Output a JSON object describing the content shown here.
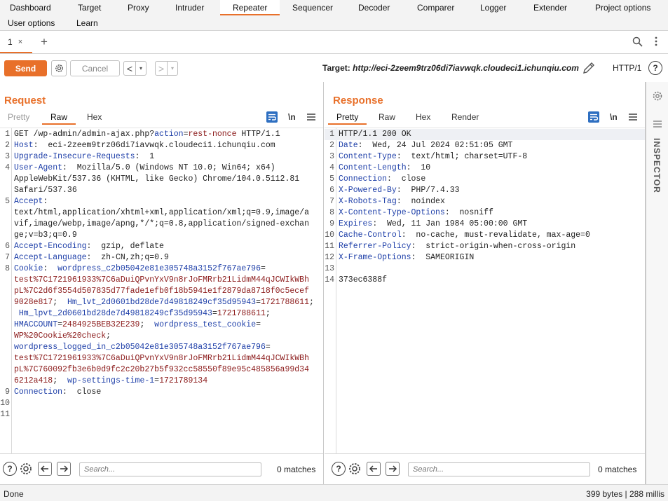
{
  "menu": {
    "row1": [
      "Dashboard",
      "Target",
      "Proxy",
      "Intruder",
      "Repeater",
      "Sequencer",
      "Decoder",
      "Comparer",
      "Logger",
      "Extender",
      "Project options"
    ],
    "row2": [
      "User options",
      "Learn"
    ],
    "active": "Repeater"
  },
  "subtab": {
    "label": "1",
    "close": "×",
    "add": "+"
  },
  "toolbar": {
    "send_label": "Send",
    "cancel_label": "Cancel",
    "prev_label": "<",
    "next_label": ">",
    "dropdown_glyph": "▾",
    "target_label": "Target:",
    "target_url": "http://eci-2zeem9trz06di7iavwqk.cloudeci1.ichunqiu.com",
    "protocol": "HTTP/1",
    "help_label": "?"
  },
  "request": {
    "title": "Request",
    "tabs": [
      "Pretty",
      "Raw",
      "Hex"
    ],
    "active_tab": "Raw",
    "newline_label": "\\n",
    "lines": [
      {
        "n": "1",
        "parts": [
          [
            "v",
            "GET /wp-admin/admin-ajax.php?"
          ],
          [
            "k",
            "action"
          ],
          [
            "v",
            "="
          ],
          [
            "p",
            "rest-nonce"
          ],
          [
            "v",
            " HTTP/1.1"
          ]
        ]
      },
      {
        "n": "2",
        "parts": [
          [
            "k",
            "Host"
          ],
          [
            "v",
            ":  eci-2zeem9trz06di7iavwqk.cloudeci1.ichunqiu.com"
          ]
        ]
      },
      {
        "n": "3",
        "parts": [
          [
            "k",
            "Upgrade-Insecure-Requests"
          ],
          [
            "v",
            ":  1"
          ]
        ]
      },
      {
        "n": "4",
        "parts": [
          [
            "k",
            "User-Agent"
          ],
          [
            "v",
            ":  Mozilla/5.0 (Windows NT 10.0; Win64; x64)"
          ]
        ]
      },
      {
        "n": "",
        "parts": [
          [
            "v",
            "AppleWebKit/537.36 (KHTML, like Gecko) Chrome/104.0.5112.81"
          ]
        ]
      },
      {
        "n": "",
        "parts": [
          [
            "v",
            "Safari/537.36"
          ]
        ]
      },
      {
        "n": "5",
        "parts": [
          [
            "k",
            "Accept"
          ],
          [
            "v",
            ":"
          ]
        ]
      },
      {
        "n": "",
        "parts": [
          [
            "v",
            "text/html,application/xhtml+xml,application/xml;q=0.9,image/a"
          ]
        ]
      },
      {
        "n": "",
        "parts": [
          [
            "v",
            "vif,image/webp,image/apng,*/*;q=0.8,application/signed-exchan"
          ]
        ]
      },
      {
        "n": "",
        "parts": [
          [
            "v",
            "ge;v=b3;q=0.9"
          ]
        ]
      },
      {
        "n": "6",
        "parts": [
          [
            "k",
            "Accept-Encoding"
          ],
          [
            "v",
            ":  gzip, deflate"
          ]
        ]
      },
      {
        "n": "7",
        "parts": [
          [
            "k",
            "Accept-Language"
          ],
          [
            "v",
            ":  zh-CN,zh;q=0.9"
          ]
        ]
      },
      {
        "n": "8",
        "parts": [
          [
            "k",
            "Cookie"
          ],
          [
            "v",
            ":  "
          ],
          [
            "k",
            "wordpress_c2b05042e81e305748a3152f767ae796"
          ],
          [
            "v",
            "="
          ]
        ]
      },
      {
        "n": "",
        "parts": [
          [
            "p",
            "test%7C1721961933%7C6aDuiQPvnYxV9n8rJoFMRrb21LidmM44qJCWIkWBh"
          ]
        ]
      },
      {
        "n": "",
        "parts": [
          [
            "p",
            "pL%7C2d6f3554d507835d77fade1efb0f18b5941e1f2879da8718f0c5ecef"
          ]
        ]
      },
      {
        "n": "",
        "parts": [
          [
            "p",
            "9028e817"
          ],
          [
            "v",
            ";  "
          ],
          [
            "k",
            "Hm_lvt_2d0601bd28de7d49818249cf35d95943"
          ],
          [
            "v",
            "="
          ],
          [
            "p",
            "1721788611"
          ],
          [
            "v",
            ";"
          ]
        ]
      },
      {
        "n": "",
        "parts": [
          [
            "v",
            " "
          ],
          [
            "k",
            "Hm_lpvt_2d0601bd28de7d49818249cf35d95943"
          ],
          [
            "v",
            "="
          ],
          [
            "p",
            "1721788611"
          ],
          [
            "v",
            ";"
          ]
        ]
      },
      {
        "n": "",
        "parts": [
          [
            "k",
            "HMACCOUNT"
          ],
          [
            "v",
            "="
          ],
          [
            "p",
            "2484925BEB32E239"
          ],
          [
            "v",
            ";  "
          ],
          [
            "k",
            "wordpress_test_cookie"
          ],
          [
            "v",
            "="
          ]
        ]
      },
      {
        "n": "",
        "parts": [
          [
            "p",
            "WP%20Cookie%20check"
          ],
          [
            "v",
            ";"
          ]
        ]
      },
      {
        "n": "",
        "parts": [
          [
            "k",
            "wordpress_logged_in_c2b05042e81e305748a3152f767ae796"
          ],
          [
            "v",
            "="
          ]
        ]
      },
      {
        "n": "",
        "parts": [
          [
            "p",
            "test%7C1721961933%7C6aDuiQPvnYxV9n8rJoFMRrb21LidmM44qJCWIkWBh"
          ]
        ]
      },
      {
        "n": "",
        "parts": [
          [
            "p",
            "pL%7C760092fb3e6b0d9fc2c20b27b5f932cc58550f89e95c485856a99d34"
          ]
        ]
      },
      {
        "n": "",
        "parts": [
          [
            "p",
            "6212a418"
          ],
          [
            "v",
            ";  "
          ],
          [
            "k",
            "wp-settings-time-1"
          ],
          [
            "v",
            "="
          ],
          [
            "p",
            "1721789134"
          ]
        ]
      },
      {
        "n": "9",
        "parts": [
          [
            "k",
            "Connection"
          ],
          [
            "v",
            ":  close"
          ]
        ]
      },
      {
        "n": "10",
        "parts": []
      },
      {
        "n": "11",
        "parts": []
      }
    ],
    "search_placeholder": "Search...",
    "matches": "0 matches"
  },
  "response": {
    "title": "Response",
    "tabs": [
      "Pretty",
      "Raw",
      "Hex",
      "Render"
    ],
    "active_tab": "Pretty",
    "newline_label": "\\n",
    "lines": [
      {
        "n": "1",
        "parts": [
          [
            "v",
            "HTTP/1.1 200 OK"
          ]
        ]
      },
      {
        "n": "2",
        "parts": [
          [
            "k",
            "Date"
          ],
          [
            "v",
            ":  Wed, 24 Jul 2024 02:51:05 GMT"
          ]
        ]
      },
      {
        "n": "3",
        "parts": [
          [
            "k",
            "Content-Type"
          ],
          [
            "v",
            ":  text/html; charset=UTF-8"
          ]
        ]
      },
      {
        "n": "4",
        "parts": [
          [
            "k",
            "Content-Length"
          ],
          [
            "v",
            ":  10"
          ]
        ]
      },
      {
        "n": "5",
        "parts": [
          [
            "k",
            "Connection"
          ],
          [
            "v",
            ":  close"
          ]
        ]
      },
      {
        "n": "6",
        "parts": [
          [
            "k",
            "X-Powered-By"
          ],
          [
            "v",
            ":  PHP/7.4.33"
          ]
        ]
      },
      {
        "n": "7",
        "parts": [
          [
            "k",
            "X-Robots-Tag"
          ],
          [
            "v",
            ":  noindex"
          ]
        ]
      },
      {
        "n": "8",
        "parts": [
          [
            "k",
            "X-Content-Type-Options"
          ],
          [
            "v",
            ":  nosniff"
          ]
        ]
      },
      {
        "n": "9",
        "parts": [
          [
            "k",
            "Expires"
          ],
          [
            "v",
            ":  Wed, 11 Jan 1984 05:00:00 GMT"
          ]
        ]
      },
      {
        "n": "10",
        "parts": [
          [
            "k",
            "Cache-Control"
          ],
          [
            "v",
            ":  no-cache, must-revalidate, max-age=0"
          ]
        ]
      },
      {
        "n": "11",
        "parts": [
          [
            "k",
            "Referrer-Policy"
          ],
          [
            "v",
            ":  strict-origin-when-cross-origin"
          ]
        ]
      },
      {
        "n": "12",
        "parts": [
          [
            "k",
            "X-Frame-Options"
          ],
          [
            "v",
            ":  SAMEORIGIN"
          ]
        ]
      },
      {
        "n": "13",
        "parts": []
      },
      {
        "n": "14",
        "parts": [
          [
            "v",
            "373ec6388f"
          ]
        ]
      }
    ],
    "search_placeholder": "Search...",
    "matches": "0 matches"
  },
  "inspector": {
    "label": "INSPECTOR"
  },
  "status": {
    "left": "Done",
    "right": "399 bytes | 288 millis"
  },
  "colors": {
    "accent": "#e8702a",
    "blue": "#2e6fc1",
    "header_name": "#1d3ea8",
    "param_value": "#8b1a1a"
  },
  "icons": [
    "search-icon",
    "kebab-menu-icon",
    "gear-icon",
    "pencil-icon",
    "help-icon",
    "wrap-lines-icon",
    "hamburger-icon",
    "layout-side-by-side-icon",
    "layout-stacked-icon",
    "layout-tabs-icon",
    "arrow-left-icon",
    "arrow-right-icon"
  ]
}
